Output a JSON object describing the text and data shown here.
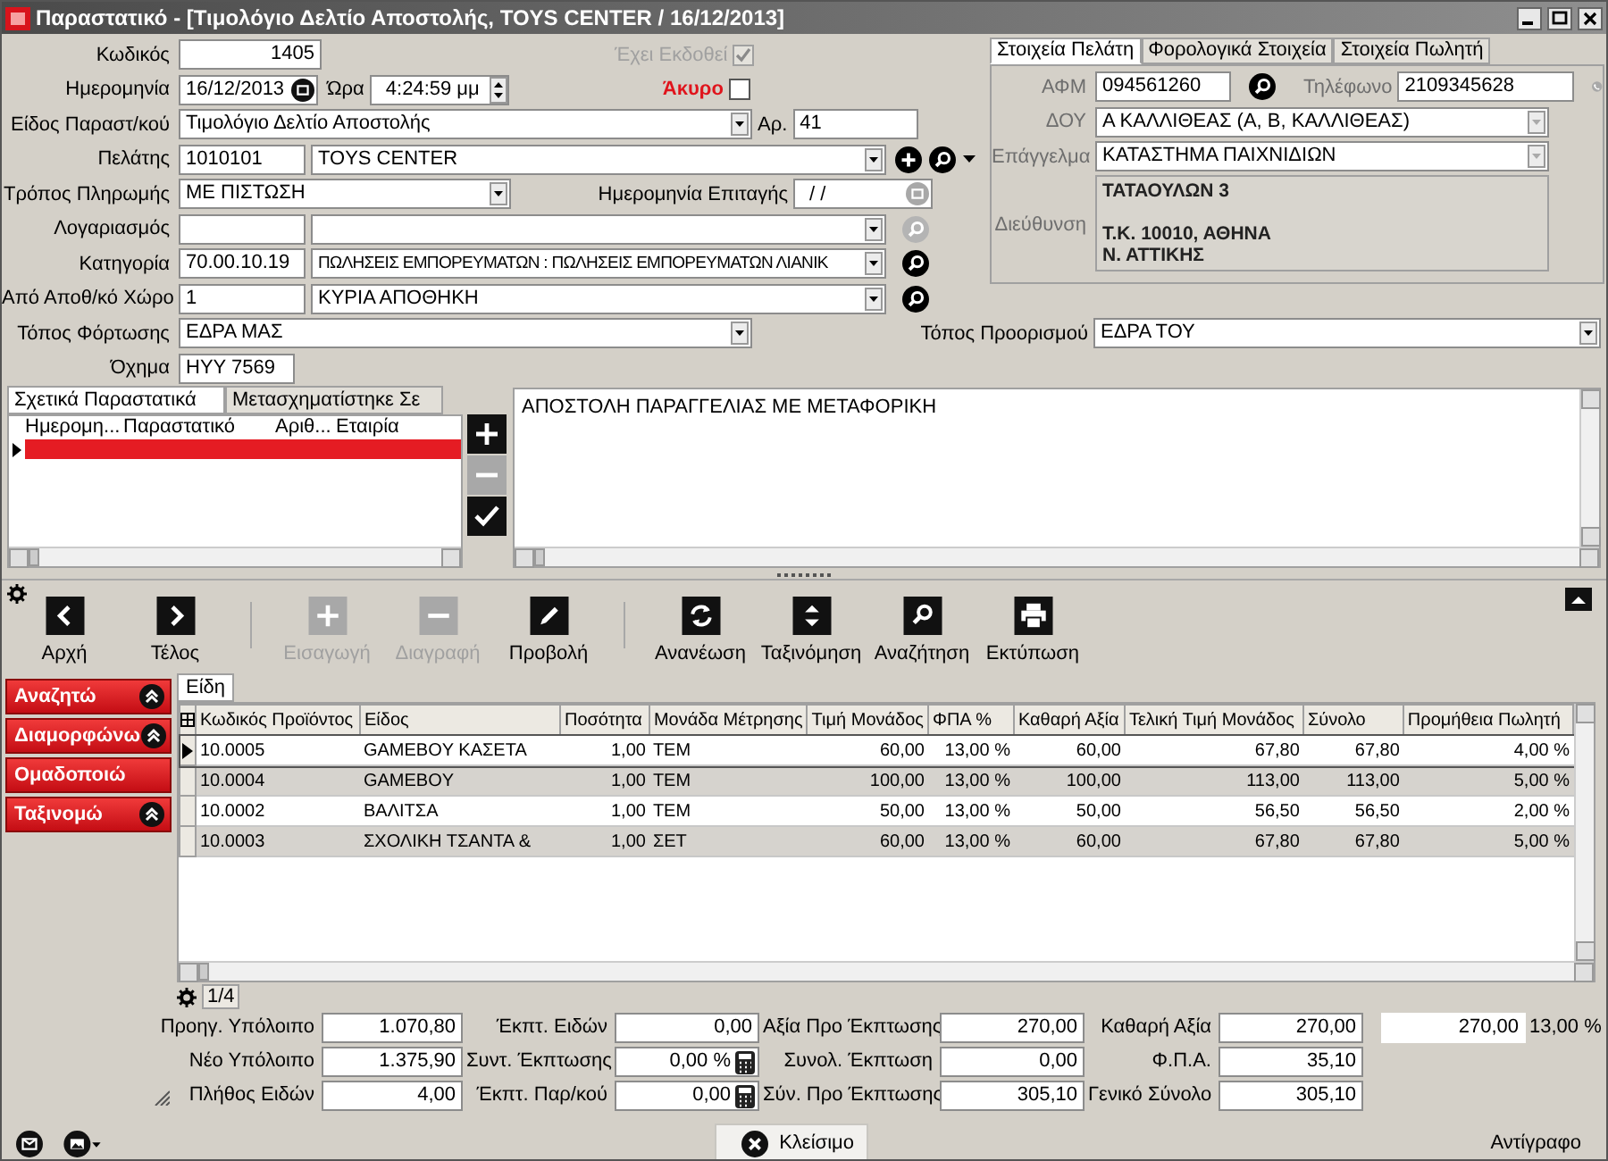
{
  "window": {
    "title": "Παραστατικό - [Τιμολόγιο Δελτίο Αποστολής, TOYS CENTER / 16/12/2013]"
  },
  "header": {
    "code": {
      "label": "Κωδικός",
      "value": "1405"
    },
    "issued": {
      "label": "Έχει Εκδοθεί",
      "checked": true,
      "disabled": true
    },
    "date": {
      "label": "Ημερομηνία",
      "value": "16/12/2013"
    },
    "time": {
      "label": "Ώρα",
      "value": "4:24:59 μμ"
    },
    "void": {
      "label": "Άκυρο",
      "checked": false
    },
    "doc_type": {
      "label": "Είδος Παραστ/κού",
      "value": "Τιμολόγιο Δελτίο Αποστολής"
    },
    "number": {
      "label": "Αρ.",
      "value": "41"
    },
    "customer": {
      "label": "Πελάτης",
      "code": "1010101",
      "name": "TOYS CENTER"
    },
    "payment": {
      "label": "Τρόπος Πληρωμής",
      "value": "ΜΕ ΠΙΣΤΩΣΗ"
    },
    "cheque_date": {
      "label": "Ημερομηνία Επιταγής",
      "value": "/ /"
    },
    "account": {
      "label": "Λογαριασμός"
    },
    "category": {
      "label": "Κατηγορία",
      "code": "70.00.10.19",
      "name": "ΠΩΛΗΣΕΙΣ ΕΜΠΟΡΕΥΜΑΤΩΝ : ΠΩΛΗΣΕΙΣ ΕΜΠΟΡΕΥΜΑΤΩΝ ΛΙΑΝΙΚ"
    },
    "warehouse": {
      "label": "Από Αποθ/κό Χώρο",
      "code": "1",
      "name": "ΚΥΡΙΑ ΑΠΟΘΗΚΗ"
    },
    "loading": {
      "label": "Τόπος Φόρτωσης",
      "value": "ΕΔΡΑ ΜΑΣ"
    },
    "destination": {
      "label": "Τόπος Προορισμού",
      "value": "ΕΔΡΑ ΤΟΥ"
    },
    "vehicle": {
      "label": "Όχημα",
      "value": "ΗΥΥ 7569"
    }
  },
  "customer_panel": {
    "tabs": [
      {
        "label": "Στοιχεία Πελάτη",
        "selected": true
      },
      {
        "label": "Φορολογικά Στοιχεία",
        "selected": false
      },
      {
        "label": "Στοιχεία Πωλητή",
        "selected": false
      }
    ],
    "vat_no": {
      "label": "ΑΦΜ",
      "value": "094561260"
    },
    "phone": {
      "label": "Τηλέφωνο",
      "value": "2109345628"
    },
    "tax_office": {
      "label": "ΔΟΥ",
      "value": "Α ΚΑΛΛΙΘΕΑΣ (Α, Β, ΚΑΛΛΙΘΕΑΣ)"
    },
    "profession": {
      "label": "Επάγγελμα",
      "value": "ΚΑΤΑΣΤΗΜΑ ΠΑΙΧΝΙΔΙΩΝ"
    },
    "address": {
      "label": "Διεύθυνση",
      "street": "ΤΑΤΑΟΥΛΩΝ 3",
      "city_lines": [
        "Τ.Κ. 10010, ΑΘΗΝΑ",
        "Ν. ΑΤΤΙΚΗΣ"
      ]
    }
  },
  "related_docs": {
    "tabs": [
      {
        "label": "Σχετικά Παραστατικά",
        "selected": true
      },
      {
        "label": "Μετασχηματίστηκε Σε",
        "selected": false
      }
    ],
    "columns": [
      "Ημερομη...",
      "Παραστατικό",
      "Αριθ...",
      "Εταιρία"
    ],
    "rows": [
      {
        "selected": true
      }
    ],
    "actions": [
      {
        "kind": "add",
        "disabled": false
      },
      {
        "kind": "remove",
        "disabled": true
      },
      {
        "kind": "confirm",
        "disabled": false
      }
    ]
  },
  "notes": "ΑΠΟΣΤΟΛΗ ΠΑΡΑΓΓΕΛΙΑΣ ΜΕ ΜΕΤΑΦΟΡΙΚΗ",
  "toolbar": [
    {
      "kind": "first",
      "label": "Αρχή",
      "disabled": false
    },
    {
      "kind": "last",
      "label": "Τέλος",
      "disabled": false
    },
    {
      "kind": "separator"
    },
    {
      "kind": "add",
      "label": "Εισαγωγή",
      "disabled": true
    },
    {
      "kind": "delete",
      "label": "Διαγραφή",
      "disabled": true
    },
    {
      "kind": "edit",
      "label": "Προβολή",
      "disabled": false
    },
    {
      "kind": "separator"
    },
    {
      "kind": "refresh",
      "label": "Ανανέωση",
      "disabled": false
    },
    {
      "kind": "sort",
      "label": "Ταξινόμηση",
      "disabled": false
    },
    {
      "kind": "search",
      "label": "Αναζήτηση",
      "disabled": false
    },
    {
      "kind": "print",
      "label": "Εκτύπωση",
      "disabled": false
    }
  ],
  "side_buttons": [
    {
      "label": "Αναζητώ",
      "kind": "toggle"
    },
    {
      "label": "Διαμορφώνω",
      "kind": "toggle"
    },
    {
      "label": "Ομαδοποιώ",
      "kind": "plain"
    },
    {
      "label": "Ταξινομώ",
      "kind": "toggle"
    }
  ],
  "items": {
    "tab": {
      "label": "Είδη",
      "selected": true
    },
    "columns": [
      "Κωδικός Προϊόντος",
      "Είδος",
      "Ποσότητα",
      "Μονάδα Μέτρησης",
      "Τιμή Μονάδος",
      "ΦΠΑ %",
      "Καθαρή Αξία",
      "Τελική Τιμή Μονάδος",
      "Σύνολο",
      "Προμήθεια Πωλητή"
    ],
    "rows": [
      {
        "selected": true,
        "cells": [
          "10.0005",
          "GAMEBOY ΚΑΣΕΤΑ",
          "1,00",
          "ΤΕΜ",
          "60,00",
          "13,00 %",
          "60,00",
          "67,80",
          "67,80",
          "4,00 %"
        ]
      },
      {
        "selected": false,
        "cells": [
          "10.0004",
          "GAMEBOY",
          "1,00",
          "ΤΕΜ",
          "100,00",
          "13,00 %",
          "100,00",
          "113,00",
          "113,00",
          "5,00 %"
        ]
      },
      {
        "selected": false,
        "cells": [
          "10.0002",
          "ΒΑΛΙΤΣΑ",
          "1,00",
          "ΤΕΜ",
          "50,00",
          "13,00 %",
          "50,00",
          "56,50",
          "56,50",
          "2,00 %"
        ]
      },
      {
        "selected": false,
        "cells": [
          "10.0003",
          "ΣΧΟΛΙΚΗ ΤΣΑΝΤΑ &",
          "1,00",
          "ΣΕΤ",
          "60,00",
          "13,00 %",
          "60,00",
          "67,80",
          "67,80",
          "5,00 %"
        ]
      }
    ],
    "page": "1/4"
  },
  "totals": {
    "rows": [
      [
        {
          "label": "Προηγ. Υπόλοιπο",
          "value": "1.070,80",
          "calculator": false
        },
        {
          "label": "Έκπτ. Ειδών",
          "value": "0,00",
          "calculator": false
        },
        {
          "label": "Αξία Προ Έκπτωσης",
          "value": "270,00",
          "calculator": false
        },
        {
          "label": "Καθαρή Αξία",
          "value": "270,00",
          "calculator": false
        }
      ],
      [
        {
          "label": "Νέο Υπόλοιπο",
          "value": "1.375,90",
          "calculator": false
        },
        {
          "label": "Συντ. Έκπτωσης",
          "value": "0,00 %",
          "calculator": true
        },
        {
          "label": "Συνολ. Έκπτωση",
          "value": "0,00",
          "calculator": false
        },
        {
          "label": "Φ.Π.Α.",
          "value": "35,10",
          "calculator": false
        }
      ],
      [
        {
          "label": "Πλήθος Ειδών",
          "value": "4,00",
          "calculator": false
        },
        {
          "label": "Έκπτ. Παρ/κού",
          "value": "0,00",
          "calculator": true
        },
        {
          "label": "Σύν. Προ Έκπτωσης",
          "value": "305,10",
          "calculator": false
        },
        {
          "label": "Γενικό Σύνολο",
          "value": "305,10",
          "calculator": false
        }
      ]
    ],
    "vat_breakdown": {
      "value": "270,00",
      "rate": "13,00 %"
    }
  },
  "footer": {
    "close_button": "Κλείσιμο",
    "status": "Αντίγραφο"
  }
}
